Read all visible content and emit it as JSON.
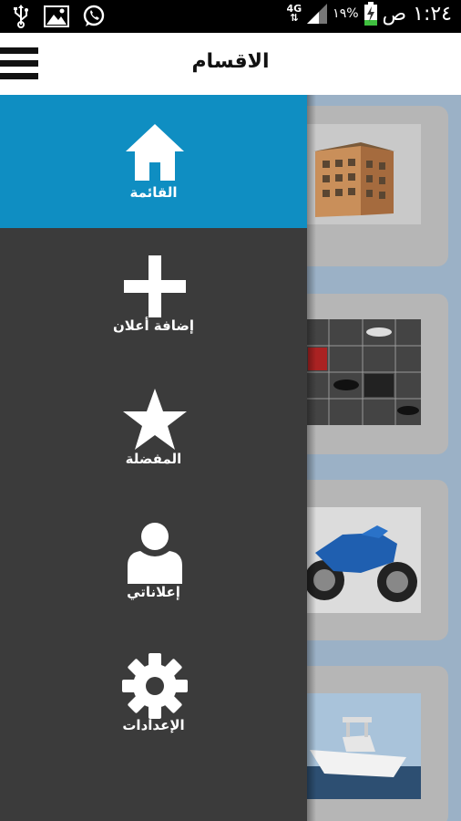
{
  "status_bar": {
    "time": "١:٢٤ ص",
    "battery_percent": "١٩%",
    "network": "4G"
  },
  "app_bar": {
    "title": "الاقسام"
  },
  "drawer": {
    "items": [
      {
        "label": "القائمة",
        "icon": "home-icon",
        "active": true
      },
      {
        "label": "إضافة أعلان",
        "icon": "plus-icon",
        "active": false
      },
      {
        "label": "المفضلة",
        "icon": "star-icon",
        "active": false
      },
      {
        "label": "إعلاناتي",
        "icon": "user-icon",
        "active": false
      },
      {
        "label": "الإعدادات",
        "icon": "gear-icon",
        "active": false
      }
    ]
  },
  "colors": {
    "drawer_bg": "#3b3b3b",
    "active_item_bg": "#0f8ec2",
    "content_bg": "#9bb1c6",
    "card_bg": "#b6b6b6"
  }
}
